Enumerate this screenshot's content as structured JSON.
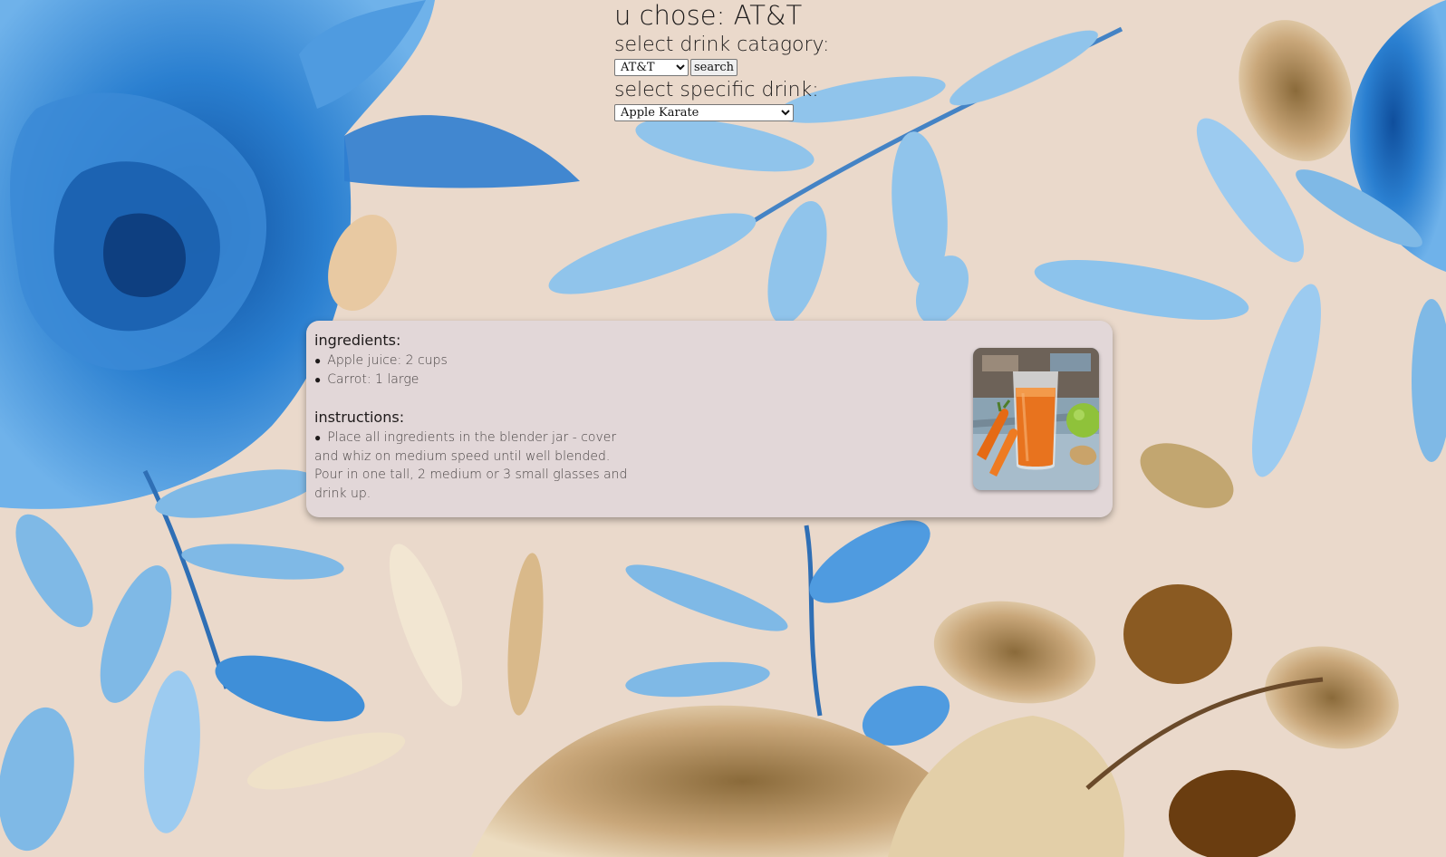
{
  "heading": "u chose: AT&T",
  "category": {
    "label": "select drink catagory:",
    "selected": "AT&T",
    "search_label": "search"
  },
  "drink": {
    "label": "select specific drink:",
    "selected": "Apple Karate"
  },
  "recipe": {
    "ingredients_title": "ingredients:",
    "ingredients": [
      "Apple juice: 2 cups",
      "Carrot: 1 large"
    ],
    "instructions_title": "instructions:",
    "instructions": "Place all ingredients in the blender jar - cover and whiz on medium speed until well blended. Pour in one tall, 2 medium or 3 small glasses and drink up."
  },
  "colors": {
    "background": "#ead9cb",
    "card": "#e2d7d8",
    "leaf_blue": "#7fb9e6",
    "rose_blue": "#1f6fbf",
    "leaf_tan": "#c9a77a",
    "leaf_brown": "#7a5020"
  }
}
